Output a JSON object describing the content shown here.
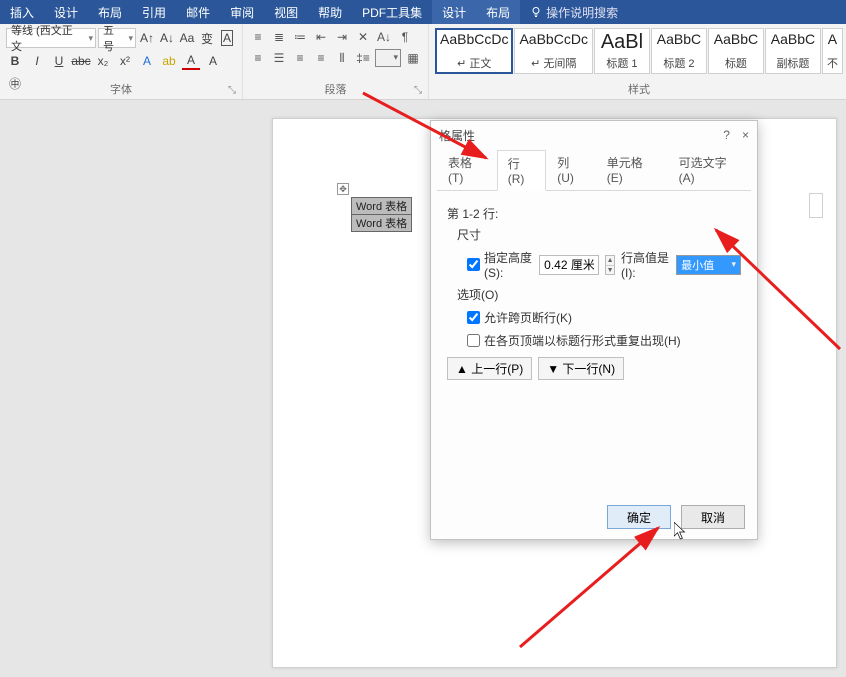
{
  "menu": {
    "items": [
      "插入",
      "设计",
      "布局",
      "引用",
      "邮件",
      "审阅",
      "视图",
      "帮助",
      "PDF工具集",
      "设计",
      "布局"
    ],
    "active_indices": [
      9,
      10
    ],
    "search_hint": "操作说明搜索"
  },
  "ribbon": {
    "font": {
      "font_name": "等线 (西文正文",
      "font_size": "五号",
      "group_label": "字体"
    },
    "para": {
      "group_label": "段落"
    },
    "styles": {
      "items": [
        {
          "preview": "AaBbCcDc",
          "label": "↵ 正文",
          "selected": true,
          "big": false
        },
        {
          "preview": "AaBbCcDc",
          "label": "↵ 无间隔",
          "selected": false,
          "big": false
        },
        {
          "preview": "AaBl",
          "label": "标题 1",
          "selected": false,
          "big": true
        },
        {
          "preview": "AaBbC",
          "label": "标题 2",
          "selected": false,
          "big": false
        },
        {
          "preview": "AaBbC",
          "label": "标题",
          "selected": false,
          "big": false
        },
        {
          "preview": "AaBbC",
          "label": "副标题",
          "selected": false,
          "big": false
        },
        {
          "preview": "A",
          "label": "不",
          "selected": false,
          "big": false
        }
      ],
      "group_label": "样式"
    }
  },
  "document": {
    "table_rows": [
      "Word 表格",
      "Word 表格"
    ]
  },
  "dialog": {
    "title": "格属性",
    "help": "?",
    "close": "×",
    "tabs": [
      {
        "label": "表格(T)",
        "active": false
      },
      {
        "label": "行(R)",
        "active": true
      },
      {
        "label": "列(U)",
        "active": false
      },
      {
        "label": "单元格(E)",
        "active": false
      },
      {
        "label": "可选文字(A)",
        "active": false
      }
    ],
    "section_header": "第 1-2 行:",
    "size_label": "尺寸",
    "specify_height_label": "指定高度(S):",
    "specify_height_checked": true,
    "height_value": "0.42 厘米",
    "row_height_is_label": "行高值是(I):",
    "row_height_is_value": "最小值",
    "options_label": "选项(O)",
    "allow_break_label": "允许跨页断行(K)",
    "allow_break_checked": true,
    "repeat_header_label": "在各页顶端以标题行形式重复出现(H)",
    "repeat_header_checked": false,
    "prev_row_btn": "▲ 上一行(P)",
    "next_row_btn": "▼ 下一行(N)",
    "ok": "确定",
    "cancel": "取消"
  }
}
